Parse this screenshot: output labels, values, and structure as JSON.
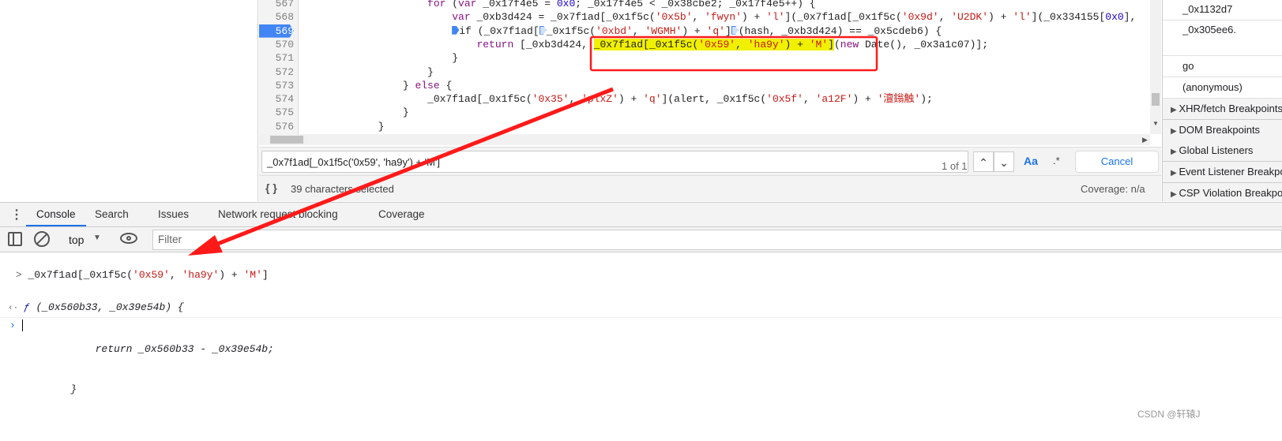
{
  "editor": {
    "lines": [
      {
        "num": "567",
        "tokens": [
          [
            "                    ",
            ""
          ],
          [
            "for",
            "kw"
          ],
          [
            " (",
            ""
          ],
          [
            "var",
            "kw"
          ],
          [
            " _0x17f4e5 = ",
            ""
          ],
          [
            "0x0",
            "num"
          ],
          [
            "; _0x17f4e5 < _0x38cbe2; _0x17f4e5++) {",
            ""
          ]
        ]
      },
      {
        "num": "568",
        "tokens": [
          [
            "                        ",
            ""
          ],
          [
            "var",
            "kw"
          ],
          [
            " _0xb3d424 = _0x7f1ad[_0x1f5c(",
            ""
          ],
          [
            "'0x5b'",
            "str"
          ],
          [
            ", ",
            ""
          ],
          [
            "'fwyn'",
            "str"
          ],
          [
            ") + ",
            ""
          ],
          [
            "'l'",
            "str"
          ],
          [
            "](_0x7f1ad[_0x1f5c(",
            ""
          ],
          [
            "'0x9d'",
            "str"
          ],
          [
            ", ",
            ""
          ],
          [
            "'U2DK'",
            "str"
          ],
          [
            ") + ",
            ""
          ],
          [
            "'l'",
            "str"
          ],
          [
            "](_0x334155[",
            ""
          ],
          [
            "0x0",
            "num"
          ],
          [
            "],",
            ""
          ]
        ]
      },
      {
        "num": "569",
        "breakpoint": true,
        "tokens": [
          [
            "                        ",
            ""
          ],
          [
            "@bpon",
            ""
          ],
          [
            "if (_0x7f1ad[",
            ""
          ],
          [
            "@bp",
            ""
          ],
          [
            "_0x1f5c(",
            ""
          ],
          [
            "'0xbd'",
            "str"
          ],
          [
            ", ",
            ""
          ],
          [
            "'WGMH'",
            "str"
          ],
          [
            ") + ",
            ""
          ],
          [
            "'q'",
            "str"
          ],
          [
            "]",
            ""
          ],
          [
            "@bp",
            ""
          ],
          [
            "(hash, _0xb3d424) == _0x5cdeb6) {",
            ""
          ]
        ]
      },
      {
        "num": "570",
        "tokens": [
          [
            "                            ",
            ""
          ],
          [
            "return",
            "kw"
          ],
          [
            " [_0xb3d424, ",
            ""
          ],
          [
            "_0x7f1ad[_0x1f5c(",
            "hl"
          ],
          [
            "'0x59'",
            "str hl"
          ],
          [
            ", ",
            "hl"
          ],
          [
            "'ha9y'",
            "str hl"
          ],
          [
            ") + ",
            "hl"
          ],
          [
            "'M'",
            "str hl"
          ],
          [
            "]",
            "hl"
          ],
          [
            "(",
            ""
          ],
          [
            "new",
            "kw"
          ],
          [
            " Date(), _0x3a1c07)];",
            ""
          ]
        ]
      },
      {
        "num": "571",
        "tokens": [
          [
            "                        }",
            ""
          ]
        ]
      },
      {
        "num": "572",
        "tokens": [
          [
            "                    }",
            ""
          ]
        ]
      },
      {
        "num": "573",
        "tokens": [
          [
            "                } ",
            ""
          ],
          [
            "else",
            "kw"
          ],
          [
            " {",
            ""
          ]
        ]
      },
      {
        "num": "574",
        "tokens": [
          [
            "                    _0x7f1ad[_0x1f5c(",
            ""
          ],
          [
            "'0x35'",
            "str"
          ],
          [
            ", ",
            ""
          ],
          [
            "'plxZ'",
            "str"
          ],
          [
            ") + ",
            ""
          ],
          [
            "'q'",
            "str"
          ],
          [
            "](alert, _0x1f5c(",
            ""
          ],
          [
            "'0x5f'",
            "str"
          ],
          [
            ", ",
            ""
          ],
          [
            "'a12F'",
            "str"
          ],
          [
            ") + ",
            ""
          ],
          [
            "'澶鎓触'",
            "str"
          ],
          [
            ");",
            ""
          ]
        ]
      },
      {
        "num": "575",
        "tokens": [
          [
            "                }",
            ""
          ]
        ]
      },
      {
        "num": "576",
        "tokens": [
          [
            "            }",
            ""
          ]
        ]
      }
    ]
  },
  "search": {
    "value": "_0x7f1ad[_0x1f5c('0x59', 'ha9y') + 'M']",
    "matches": "1 of 1",
    "match_case": "Aa",
    "regex": ".*",
    "cancel": "Cancel"
  },
  "status": {
    "selection": "39 characters selected",
    "coverage": "Coverage: n/a"
  },
  "right_panel": {
    "scope_items": [
      "_0x1132d7",
      "_0x305ee6."
    ],
    "call_stack": [
      "go",
      "(anonymous)"
    ],
    "sections": [
      "XHR/fetch Breakpoints",
      "DOM Breakpoints",
      "Global Listeners",
      "Event Listener Breakpoints",
      "CSP Violation Breakpoints"
    ]
  },
  "drawer_tabs": [
    "Console",
    "Search",
    "Issues",
    "Network request blocking",
    "Coverage"
  ],
  "console_toolbar": {
    "context": "top",
    "filter_placeholder": "Filter"
  },
  "console": {
    "input_tokens": [
      [
        "_0x7f1ad[_0x1f5c(",
        ""
      ],
      [
        "'0x59'",
        "str"
      ],
      [
        ", ",
        ""
      ],
      [
        "'ha9y'",
        "str"
      ],
      [
        ") + ",
        ""
      ],
      [
        "'M'",
        "str"
      ],
      [
        "]",
        ""
      ]
    ],
    "result_lines": [
      "(_0x560b33, _0x39e54b) {",
      "            return _0x560b33 - _0x39e54b;",
      "        }"
    ],
    "result_prefix": "ƒ"
  },
  "annotation_color": "#ff1a1a",
  "watermark": "CSDN @轩辕J"
}
